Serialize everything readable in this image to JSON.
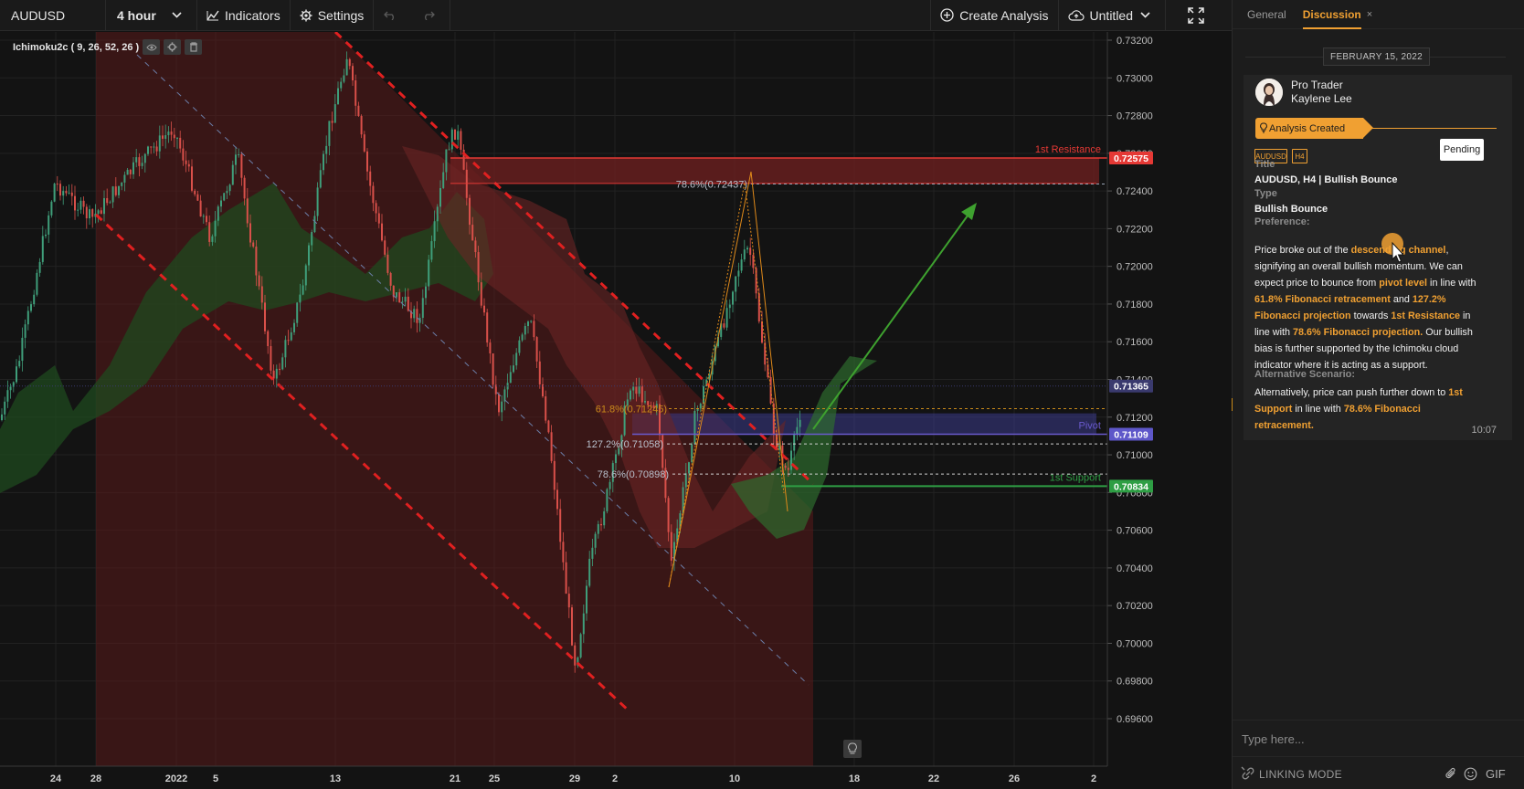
{
  "toolbar": {
    "symbol": "AUDUSD",
    "interval": "4 hour",
    "indicators_label": "Indicators",
    "settings_label": "Settings",
    "create_analysis_label": "Create Analysis",
    "layout_name": "Untitled"
  },
  "indicator": {
    "label": "Ichimoku2c ( 9, 26, 52, 26 )"
  },
  "chart_data": {
    "type": "candlestick",
    "symbol": "AUDUSD",
    "timeframe": "4 hour",
    "y_ticks": [
      "0.73200",
      "0.73000",
      "0.72800",
      "0.72600",
      "0.72400",
      "0.72200",
      "0.72000",
      "0.71800",
      "0.71600",
      "0.71400",
      "0.71200",
      "0.71000",
      "0.70800",
      "0.70600",
      "0.70400",
      "0.70200",
      "0.70000",
      "0.69800",
      "0.69600"
    ],
    "ylim": [
      0.696,
      0.732
    ],
    "x_ticks": [
      "24",
      "28",
      "2022",
      "5",
      "13",
      "21",
      "25",
      "29",
      "2",
      "10",
      "18",
      "22",
      "26",
      "2"
    ],
    "price_labels": [
      {
        "value": "0.72575",
        "color": "#e53935"
      },
      {
        "value": "0.71365",
        "color": "#3a3a6e"
      },
      {
        "value": "0.71109",
        "color": "#5e57c9"
      },
      {
        "value": "0.70834",
        "color": "#2e9e44"
      }
    ],
    "levels": [
      {
        "name": "1st Resistance",
        "price": 0.72575,
        "color": "#e53935"
      },
      {
        "name": "Pivot",
        "price": 0.71109,
        "color": "#6a5acd"
      },
      {
        "name": "1st Support",
        "price": 0.70834,
        "color": "#2e9e44"
      }
    ],
    "fib_labels": [
      {
        "text": "78.6%(0.72437)",
        "price": 0.72437
      },
      {
        "text": "61.8%(0.71245)",
        "price": 0.71245
      },
      {
        "text": "127.2%(0.71058)",
        "price": 0.71058
      },
      {
        "text": "78.6%(0.70898)",
        "price": 0.70898
      }
    ]
  },
  "panel": {
    "tab_general": "General",
    "tab_discussion": "Discussion",
    "tab_close": "×",
    "date": "FEBRUARY 15, 2022",
    "author_role": "Pro Trader",
    "author_name": "Kaylene Lee",
    "event": "Analysis Created",
    "tags": [
      "AUDUSD",
      "H4"
    ],
    "status": "Pending",
    "title_label": "Title",
    "title_value": "AUDUSD, H4 | Bullish Bounce",
    "type_label": "Type",
    "type_value": "Bullish Bounce",
    "preference_label": "Preference:",
    "preference": [
      {
        "text": "Price broke out of the ",
        "hl": false
      },
      {
        "text": "descending channel",
        "hl": true
      },
      {
        "text": ", signifying an overall bullish momentum. We can expect price to bounce from ",
        "hl": false
      },
      {
        "text": "pivot level",
        "hl": true
      },
      {
        "text": " in line with ",
        "hl": false
      },
      {
        "text": "61.8% Fibonacci retracement",
        "hl": true
      },
      {
        "text": " and ",
        "hl": false
      },
      {
        "text": "127.2% Fibonacci projection",
        "hl": true
      },
      {
        "text": " towards ",
        "hl": false
      },
      {
        "text": "1st Resistance",
        "hl": true
      },
      {
        "text": " in line with ",
        "hl": false
      },
      {
        "text": "78.6% Fibonacci projection.",
        "hl": true
      },
      {
        "text": "  Our bullish bias is further supported by the Ichimoku cloud indicator where it is acting as a support.",
        "hl": false
      }
    ],
    "alternative_label": "Alternative Scenario:",
    "alternative": [
      {
        "text": "Alternatively, price can push further down to ",
        "hl": false
      },
      {
        "text": "1st Support",
        "hl": true
      },
      {
        "text": " in line with ",
        "hl": false
      },
      {
        "text": "78.6% Fibonacci retracement.",
        "hl": true
      }
    ],
    "time": "10:07",
    "input_placeholder": "Type here...",
    "linking_mode": "LINKING MODE",
    "gif_label": "GIF"
  }
}
